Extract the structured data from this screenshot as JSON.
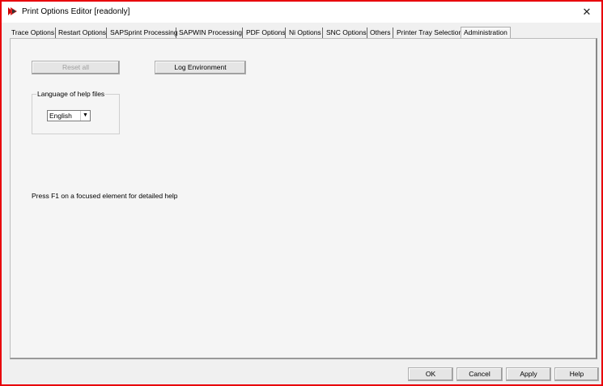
{
  "window": {
    "title": "Print Options Editor [readonly]",
    "close_icon": "close-icon"
  },
  "tabs": [
    "Trace Options",
    "Restart Options",
    "SAPSprint Processing",
    "SAPWIN Processing",
    "PDF Options",
    "Ni Options",
    "SNC Options",
    "Others",
    "Printer Tray Selection",
    "Administration"
  ],
  "active_tab": "Administration",
  "panel": {
    "reset_all_label": "Reset all",
    "log_environment_label": "Log Environment",
    "language_group_label": "Language of help files",
    "language_value": "English",
    "help_text": "Press F1 on a focused element for detailed help"
  },
  "footer": {
    "ok": "OK",
    "cancel": "Cancel",
    "apply": "Apply",
    "help": "Help"
  },
  "colors": {
    "frame": "#e8000b"
  }
}
